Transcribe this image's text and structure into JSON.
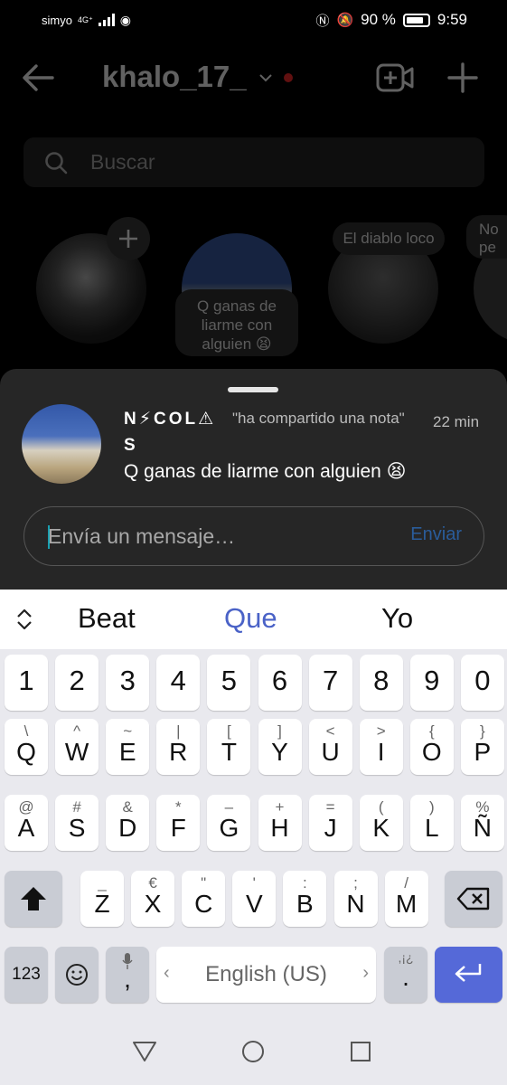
{
  "status_bar": {
    "carrier": "simyo",
    "network": "4G⁺",
    "battery": "90 %",
    "time": "9:59"
  },
  "header": {
    "username": "khalo_17_"
  },
  "search": {
    "placeholder": "Buscar"
  },
  "stories": [
    {
      "bubble": "",
      "name": ""
    },
    {
      "bubble": "Q ganas de liarme con alguien 😫",
      "name": ""
    },
    {
      "bubble": "El diablo loco",
      "name": ""
    },
    {
      "bubble": "No pe",
      "name": ""
    }
  ],
  "note_sheet": {
    "user_name": "N⚡COL⚠",
    "user_name_line2": "S",
    "shared_label": "\"ha compartido una nota\"",
    "time": "22 min",
    "note_text": "Q ganas de liarme con alguien 😫",
    "message_placeholder": "Envía un mensaje…",
    "send_label": "Enviar"
  },
  "keyboard": {
    "suggestions": [
      "Beat",
      "Que",
      "Yo"
    ],
    "row_numbers": [
      "1",
      "2",
      "3",
      "4",
      "5",
      "6",
      "7",
      "8",
      "9",
      "0"
    ],
    "row1": [
      {
        "k": "Q",
        "a": "\\"
      },
      {
        "k": "W",
        "a": "^"
      },
      {
        "k": "E",
        "a": "~"
      },
      {
        "k": "R",
        "a": "|"
      },
      {
        "k": "T",
        "a": "["
      },
      {
        "k": "Y",
        "a": "]"
      },
      {
        "k": "U",
        "a": "<"
      },
      {
        "k": "I",
        "a": ">"
      },
      {
        "k": "O",
        "a": "{"
      },
      {
        "k": "P",
        "a": "}"
      }
    ],
    "row2": [
      {
        "k": "A",
        "a": "@"
      },
      {
        "k": "S",
        "a": "#"
      },
      {
        "k": "D",
        "a": "&"
      },
      {
        "k": "F",
        "a": "*"
      },
      {
        "k": "G",
        "a": "–"
      },
      {
        "k": "H",
        "a": "+"
      },
      {
        "k": "J",
        "a": "="
      },
      {
        "k": "K",
        "a": "("
      },
      {
        "k": "L",
        "a": ")"
      },
      {
        "k": "Ñ",
        "a": "%"
      }
    ],
    "row3": [
      {
        "k": "Z",
        "a": "_"
      },
      {
        "k": "X",
        "a": "€"
      },
      {
        "k": "C",
        "a": "\""
      },
      {
        "k": "V",
        "a": "'"
      },
      {
        "k": "B",
        "a": ":"
      },
      {
        "k": "N",
        "a": ";"
      },
      {
        "k": "M",
        "a": "/"
      }
    ],
    "numbers_key": "123",
    "comma_key": ",",
    "space_label": "English (US)",
    "period_key": ".",
    "period_alt": ",¡¿"
  }
}
